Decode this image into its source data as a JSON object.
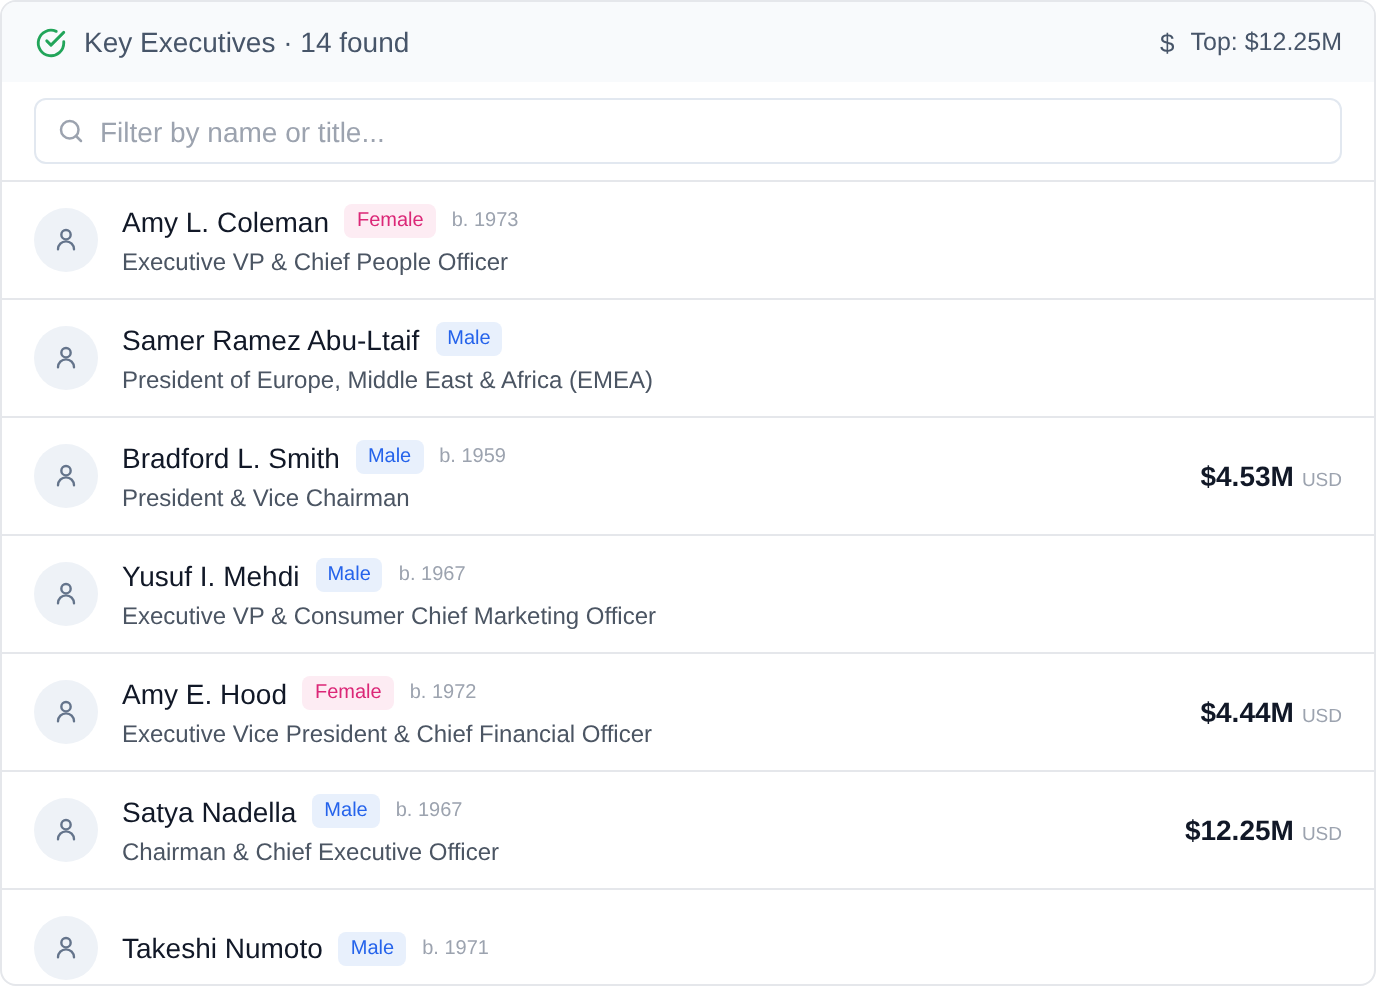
{
  "header": {
    "title": "Key Executives · 14 found",
    "currency_symbol": "$",
    "top": "Top: $12.25M"
  },
  "search": {
    "placeholder": "Filter by name or title..."
  },
  "executives": [
    {
      "name": "Amy L. Coleman",
      "badge": {
        "kind": "female",
        "label": "Female"
      },
      "born": "b. 1973",
      "title": "Executive VP & Chief People Officer"
    },
    {
      "name": "Samer Ramez Abu-Ltaif",
      "badge": {
        "kind": "male",
        "label": "Male"
      },
      "title": "President of Europe, Middle East & Africa (EMEA)"
    },
    {
      "name": "Bradford L. Smith",
      "badge": {
        "kind": "male",
        "label": "Male"
      },
      "born": "b. 1959",
      "title": "President & Vice Chairman",
      "pay": "$4.53M",
      "currency": "USD"
    },
    {
      "name": "Yusuf I. Mehdi",
      "badge": {
        "kind": "male",
        "label": "Male"
      },
      "born": "b. 1967",
      "title": "Executive VP & Consumer Chief Marketing Officer"
    },
    {
      "name": "Amy E. Hood",
      "badge": {
        "kind": "female",
        "label": "Female"
      },
      "born": "b. 1972",
      "title": "Executive Vice President & Chief Financial Officer",
      "pay": "$4.44M",
      "currency": "USD"
    },
    {
      "name": "Satya Nadella",
      "badge": {
        "kind": "male",
        "label": "Male"
      },
      "born": "b. 1967",
      "title": "Chairman & Chief Executive Officer",
      "pay": "$12.25M",
      "currency": "USD"
    },
    {
      "name": "Takeshi Numoto",
      "badge": {
        "kind": "male",
        "label": "Male"
      },
      "born": "b. 1971"
    }
  ]
}
